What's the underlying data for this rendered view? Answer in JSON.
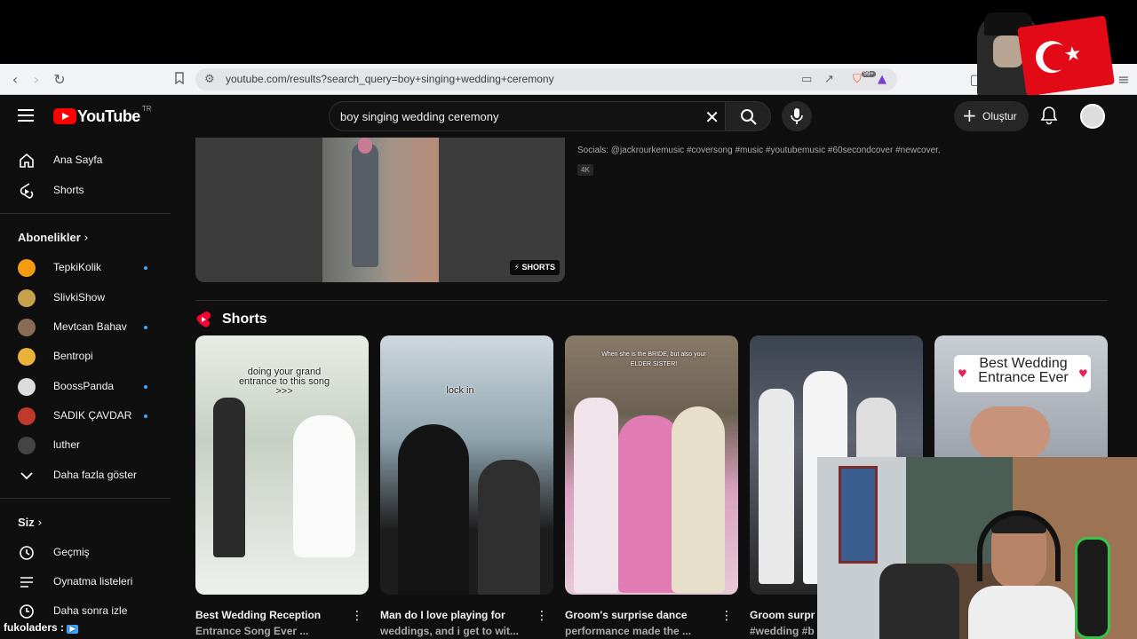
{
  "browser": {
    "url": "youtube.com/results?search_query=boy+singing+wedding+ceremony",
    "ext_badge": "99+"
  },
  "header": {
    "logo_text": "YouTube",
    "logo_region": "TR",
    "search_query": "boy singing wedding ceremony",
    "create_label": "Oluştur"
  },
  "sidebar": {
    "main_items": [
      {
        "label": "Ana Sayfa",
        "icon": "home-icon"
      },
      {
        "label": "Shorts",
        "icon": "shorts-icon"
      }
    ],
    "subscriptions_heading": "Abonelikler",
    "channels": [
      {
        "label": "TepkiKolik",
        "color": "#f39c12",
        "new": true
      },
      {
        "label": "SlivkiShow",
        "color": "#c8a24a",
        "new": false
      },
      {
        "label": "Mevtcan Bahav",
        "color": "#8a6b56",
        "new": true
      },
      {
        "label": "Bentropi",
        "color": "#e9b33a",
        "new": false
      },
      {
        "label": "BoossPanda",
        "color": "#dcdcdc",
        "new": true
      },
      {
        "label": "SADIK ÇAVDAR",
        "color": "#c0392b",
        "new": true
      },
      {
        "label": "luther",
        "color": "#444444",
        "new": false
      }
    ],
    "show_more": "Daha fazla göster",
    "you_heading": "Siz",
    "you_items": [
      {
        "label": "Geçmiş",
        "icon": "history-icon"
      },
      {
        "label": "Oynatma listeleri",
        "icon": "playlists-icon"
      },
      {
        "label": "Daha sonra izle",
        "icon": "watch-later-icon"
      }
    ]
  },
  "results": {
    "previous_video": {
      "badge": "SHORTS",
      "description": "Socials: @jackrourkemusic #coversong #music #youtubemusic #60secondcover #newcover.",
      "quality": "4K"
    },
    "shorts_heading": "Shorts",
    "shorts": [
      {
        "title1": "Best Wedding Reception",
        "title2": "Entrance Song Ever ...",
        "overlay": "doing your grand entrance to this song >>>"
      },
      {
        "title1": "Man do I love playing for",
        "title2": "weddings, and i get to wit...",
        "overlay": "lock in"
      },
      {
        "title1": "Groom's surprise dance",
        "title2": "performance made the ...",
        "overlay": "When she is the BRIDE, but also your ELDER SISTER!"
      },
      {
        "title1": "Groom surpr",
        "title2": "#wedding #b",
        "overlay": ""
      },
      {
        "title1": "",
        "title2": "",
        "overlay": "Best Wedding Entrance Ever"
      }
    ]
  },
  "overlay": {
    "watermark": "fukoladers :"
  }
}
